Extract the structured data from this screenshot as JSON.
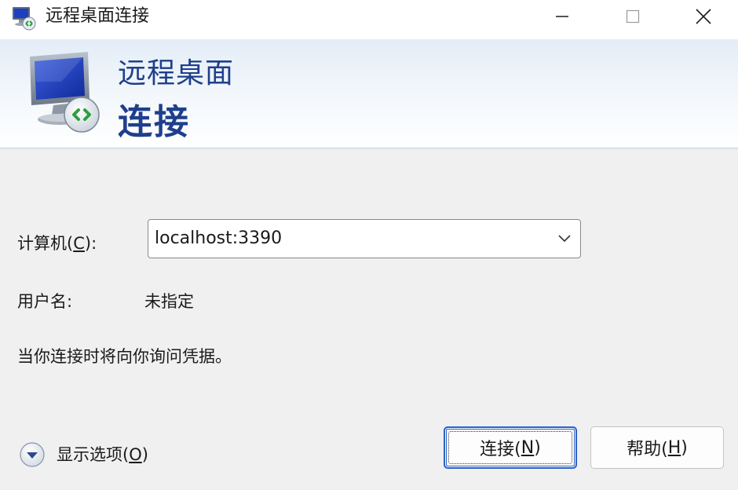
{
  "window": {
    "title": "远程桌面连接"
  },
  "banner": {
    "line1": "远程桌面",
    "line2": "连接"
  },
  "form": {
    "computer_label_prefix": "计算机(",
    "computer_label_key": "C",
    "computer_label_suffix": "):",
    "computer_value": "localhost:3390",
    "username_label": "用户名:",
    "username_value": "未指定",
    "info_text": "当你连接时将向你询问凭据。"
  },
  "options": {
    "label_prefix": "显示选项(",
    "label_key": "O",
    "label_suffix": ")"
  },
  "buttons": {
    "connect_prefix": "连接(",
    "connect_key": "N",
    "connect_suffix": ")",
    "help_prefix": "帮助(",
    "help_key": "H",
    "help_suffix": ")"
  },
  "colors": {
    "banner_text": "#1f3f8c",
    "focus_border": "#2b63c6",
    "background": "#f0f0f0"
  },
  "icons": {
    "title": "remote-desktop-icon",
    "banner": "remote-desktop-monitor-icon",
    "minimize": "minimize-icon",
    "maximize": "maximize-icon",
    "close": "close-icon",
    "dropdown": "chevron-down-icon",
    "options": "expand-circle-down-icon"
  }
}
